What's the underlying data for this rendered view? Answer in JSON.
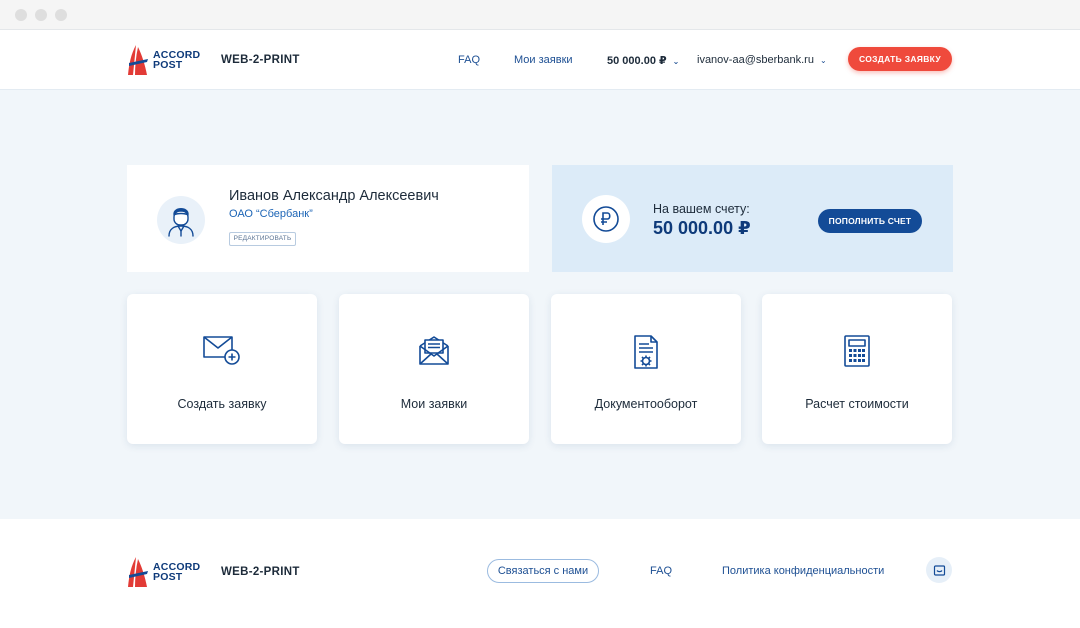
{
  "header": {
    "logo_text_line1": "ACCORD",
    "logo_text_line2": "POST",
    "brand": "WEB-2-PRINT",
    "nav_faq": "FAQ",
    "nav_my_orders": "Мои заявки",
    "balance": "50 000.00 ₽",
    "email": "ivanov-aa@sberbank.ru",
    "create_button": "СОЗДАТЬ ЗАЯВКУ"
  },
  "profile": {
    "name": "Иванов Александр Алексеевич",
    "organization": "ОАО “Сбербанк”",
    "edit_button": "РЕДАКТИРОВАТЬ"
  },
  "account": {
    "label": "На вашем счету:",
    "amount": "50 000.00 ₽",
    "topup_button": "ПОПОЛНИТЬ СЧЕТ"
  },
  "tiles": [
    {
      "label": "Создать заявку",
      "icon": "envelope-plus-icon"
    },
    {
      "label": "Мои заявки",
      "icon": "open-envelope-icon"
    },
    {
      "label": "Документооборот",
      "icon": "document-gear-icon"
    },
    {
      "label": "Расчет стоимости",
      "icon": "calculator-icon"
    }
  ],
  "footer": {
    "logo_text_line1": "ACCORD",
    "logo_text_line2": "POST",
    "brand": "WEB-2-PRINT",
    "contact_button": "Связаться с нами",
    "faq": "FAQ",
    "privacy": "Политика конфиденциальности"
  },
  "colors": {
    "accent_red": "#ef4a3c",
    "brand_blue": "#134b97",
    "page_background": "#f1f6fa"
  }
}
